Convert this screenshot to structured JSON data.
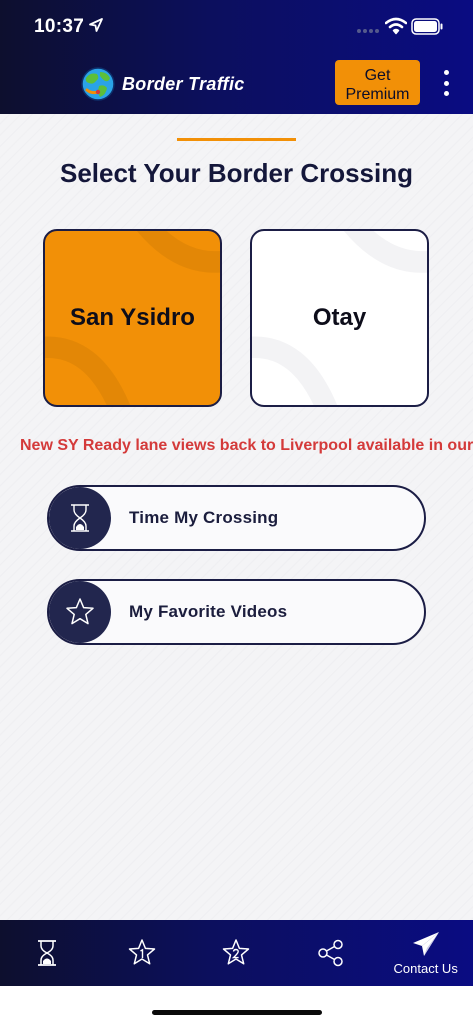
{
  "status_bar": {
    "time": "10:37"
  },
  "header": {
    "app_title": "Border Traffic",
    "premium_button": "Get Premium",
    "menu_icon": "kebab-menu-icon",
    "logo_icon": "globe-logo-icon"
  },
  "main": {
    "title": "Select Your Border Crossing",
    "crossings": [
      {
        "label": "San Ysidro",
        "selected": true
      },
      {
        "label": "Otay",
        "selected": false
      }
    ],
    "ticker": "New SY Ready lane views back to Liverpool available in our ne",
    "actions": [
      {
        "label": "Time My Crossing",
        "icon": "hourglass-icon"
      },
      {
        "label": "My Favorite Videos",
        "icon": "star-icon"
      }
    ]
  },
  "tabbar": {
    "tabs": [
      {
        "icon": "hourglass-icon",
        "label": ""
      },
      {
        "icon": "star-one-icon",
        "label": ""
      },
      {
        "icon": "star-two-icon",
        "label": ""
      },
      {
        "icon": "share-icon",
        "label": ""
      },
      {
        "icon": "paper-plane-icon",
        "label": "Contact Us"
      }
    ]
  },
  "colors": {
    "accent": "#f29007",
    "header_dark": "#0d0f2e",
    "header_blue": "#0a0c82",
    "ticker_red": "#d43a3a",
    "navy": "#1b1d45"
  }
}
